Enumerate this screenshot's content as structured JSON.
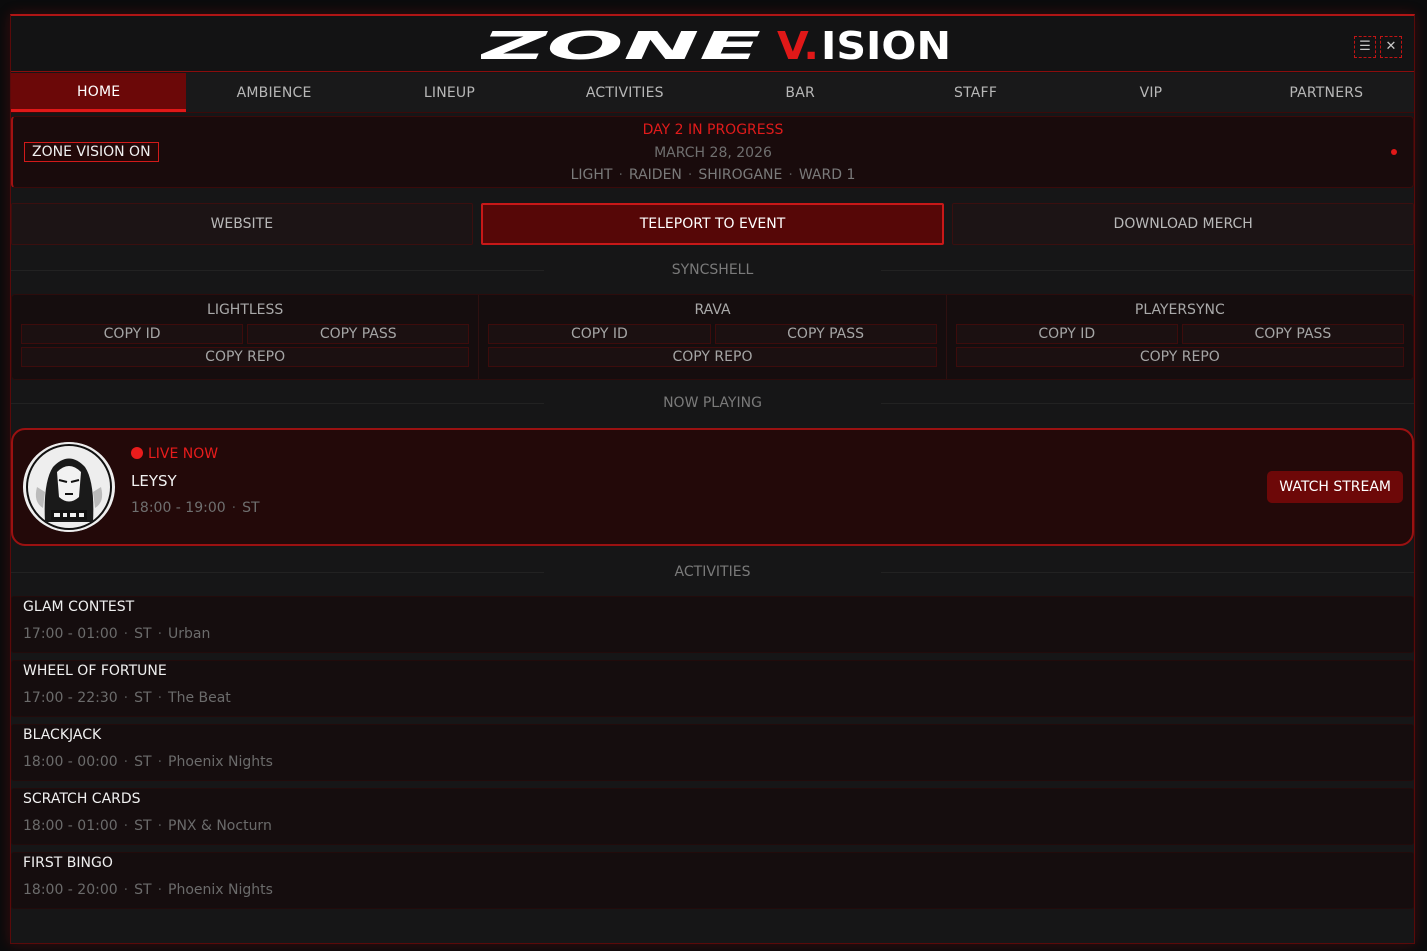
{
  "app": {
    "logo_text": "ZONE V.ISION",
    "logo_colors": {
      "primary": "#ffffff",
      "accent": "#e01818"
    }
  },
  "window_controls": {
    "menu_icon": "menu-icon",
    "close_icon": "close-icon",
    "menu_glyph": "☰",
    "close_glyph": "✕"
  },
  "tabs": [
    {
      "label": "HOME",
      "active": true
    },
    {
      "label": "AMBIENCE"
    },
    {
      "label": "LINEUP"
    },
    {
      "label": "ACTIVITIES"
    },
    {
      "label": "BAR"
    },
    {
      "label": "STAFF"
    },
    {
      "label": "VIP"
    },
    {
      "label": "PARTNERS"
    }
  ],
  "status": {
    "badge": "ZONE VISION ON",
    "title": "DAY 2 IN PROGRESS",
    "date": "MARCH 28, 2026",
    "location": [
      "LIGHT",
      "RAIDEN",
      "SHIROGANE",
      "WARD 1"
    ]
  },
  "actions": {
    "website": "WEBSITE",
    "teleport": "TELEPORT TO EVENT",
    "merch": "DOWNLOAD MERCH"
  },
  "syncshell": {
    "title": "SYNCSHELL",
    "groups": [
      {
        "name": "LIGHTLESS",
        "copy_id": "COPY ID",
        "copy_pass": "COPY PASS",
        "copy_repo": "COPY REPO"
      },
      {
        "name": "RAVA",
        "copy_id": "COPY ID",
        "copy_pass": "COPY PASS",
        "copy_repo": "COPY REPO"
      },
      {
        "name": "PLAYERSYNC",
        "copy_id": "COPY ID",
        "copy_pass": "COPY PASS",
        "copy_repo": "COPY REPO"
      }
    ]
  },
  "now_playing": {
    "title": "NOW PLAYING",
    "live_label": "LIVE NOW",
    "dj": "LEYSY",
    "time": "18:00 - 19:00",
    "tz": "ST",
    "watch_label": "WATCH STREAM"
  },
  "activities": {
    "title": "ACTIVITIES",
    "items": [
      {
        "name": "GLAM CONTEST",
        "time": "17:00 - 01:00",
        "tz": "ST",
        "venue": "Urban"
      },
      {
        "name": "WHEEL OF FORTUNE",
        "time": "17:00 - 22:30",
        "tz": "ST",
        "venue": "The Beat"
      },
      {
        "name": "BLACKJACK",
        "time": "18:00 - 00:00",
        "tz": "ST",
        "venue": "Phoenix Nights"
      },
      {
        "name": "SCRATCH CARDS",
        "time": "18:00 - 01:00",
        "tz": "ST",
        "venue": "PNX & Nocturn"
      },
      {
        "name": "FIRST BINGO",
        "time": "18:00 - 20:00",
        "tz": "ST",
        "venue": "Phoenix Nights"
      }
    ]
  },
  "separator": "·"
}
